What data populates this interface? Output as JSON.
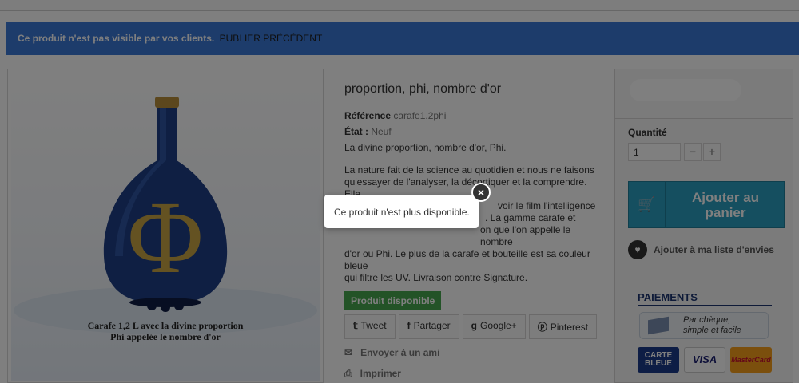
{
  "notice": {
    "text": "Ce produit n'est pas visible par vos clients.",
    "link": "PUBLIER PRÉCÉDENT"
  },
  "image": {
    "symbol": "Φ",
    "caption_line1": "Carafe 1,2 L avec la divine proportion",
    "caption_line2": "Phi appelée le nombre d'or"
  },
  "product": {
    "title_line2": "proportion, phi, nombre d'or",
    "reference_label": "Référence",
    "reference_value": "carafe1.2phi",
    "state_label": "État :",
    "state_value": "Neuf",
    "short_desc": "La divine proportion, nombre d'or, Phi.",
    "desc_line1": "La nature fait de la science au quotidien et nous ne faisons",
    "desc_line2": "qu'essayer de l'analyser, la décortiquer et la comprendre. Elle",
    "desc_line3": "voir le film l'intelligence",
    "desc_line4": ". La gamme carafe et",
    "desc_line5": "on que l'on appelle le nombre",
    "desc_line6": "d'or ou Phi. Le plus de la carafe et bouteille est sa couleur bleue",
    "desc_line7_prefix": "qui filtre les UV.",
    "desc_link": "Livraison contre Signature",
    "desc_line7_suffix": ".",
    "availability": "Produit disponible"
  },
  "share": {
    "tweet": "Tweet",
    "partager": "Partager",
    "google": "Google+",
    "pinterest": "Pinterest"
  },
  "actions": {
    "send": "Envoyer à un ami",
    "print": "Imprimer"
  },
  "buy": {
    "qty_label": "Quantité",
    "qty_value": "1",
    "minus": "−",
    "plus": "+",
    "cart_line1": "Ajouter au",
    "cart_line2": "panier",
    "wishlist": "Ajouter à ma liste d'envies"
  },
  "payments": {
    "title": "PAIEMENTS",
    "cheque_line1": "Par chèque,",
    "cheque_line2": "simple et facile",
    "card1": "CARTE BLEUE",
    "card2": "VISA",
    "card3": "MasterCard"
  },
  "modal": {
    "message": "Ce produit n'est plus disponible.",
    "close": "×"
  }
}
